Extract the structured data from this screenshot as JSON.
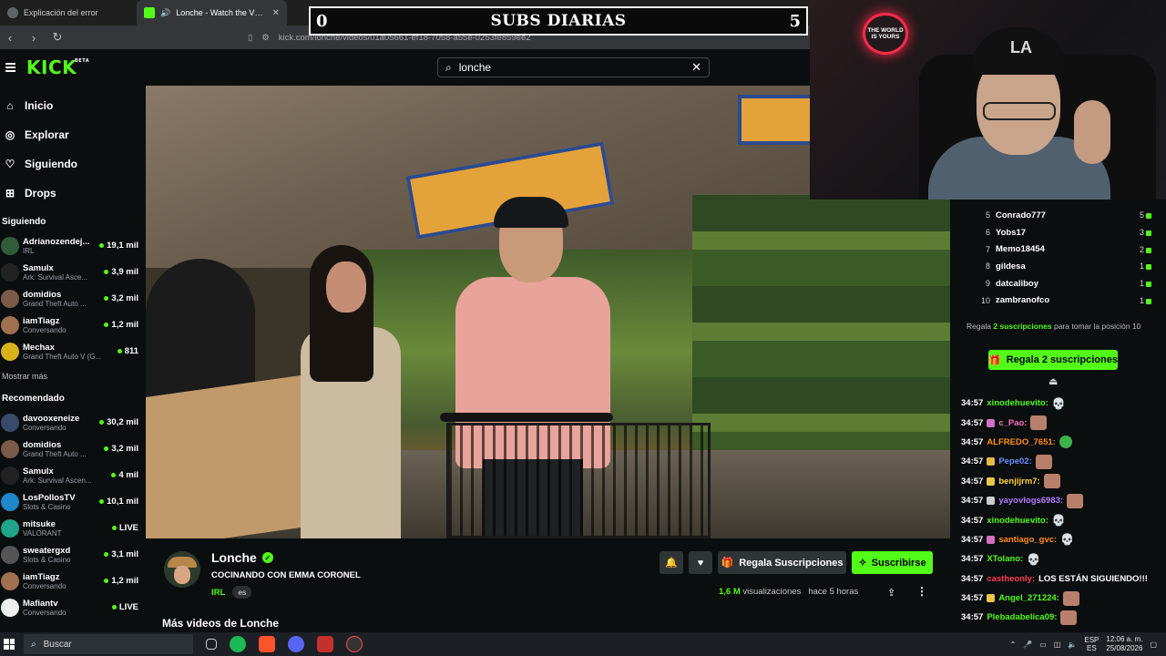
{
  "browser": {
    "tabs": [
      {
        "title": "Explicación del error",
        "active": false
      },
      {
        "title": "Lonche - Watch the VOD on Kick",
        "active": true
      }
    ],
    "url": "kick.com/lonche/videos/01a05661-ef18-7058-a55e-0253fe859ee2"
  },
  "overlay": {
    "subs_title": "SUBS DIARIAS",
    "subs_left": "0",
    "subs_right": "5",
    "neon_sign": "THE WORLD IS YOURS"
  },
  "kick": {
    "logo": "KICK",
    "logo_tag": "BETA",
    "search_value": "lonche"
  },
  "sidebar": {
    "nav": [
      {
        "label": "Inicio",
        "icon": "home-icon"
      },
      {
        "label": "Explorar",
        "icon": "compass-icon"
      },
      {
        "label": "Siguiendo",
        "icon": "heart-icon"
      },
      {
        "label": "Drops",
        "icon": "gift-icon"
      }
    ],
    "following_title": "Siguiendo",
    "following": [
      {
        "name": "Adrianozendej...",
        "category": "IRL",
        "viewers": "19,1 mil",
        "live_dot": true,
        "color": "#2f5d3a"
      },
      {
        "name": "Samulx",
        "category": "Ark: Survival Asce...",
        "viewers": "3,9 mil",
        "live_dot": true,
        "color": "#222222"
      },
      {
        "name": "domidios",
        "category": "Grand Theft Auto ...",
        "viewers": "3,2 mil",
        "live_dot": true,
        "color": "#7a5a48"
      },
      {
        "name": "iamTiagz",
        "category": "Conversando",
        "viewers": "1,2 mil",
        "live_dot": true,
        "color": "#a07050"
      },
      {
        "name": "Mechax",
        "category": "Grand Theft Auto V (G...",
        "viewers": "811",
        "live_dot": true,
        "color": "#d8b21a"
      }
    ],
    "show_more": "Mostrar más",
    "recommended_title": "Recomendado",
    "recommended": [
      {
        "name": "davooxeneize",
        "category": "Conversando",
        "viewers": "30,2 mil",
        "live_dot": true,
        "color": "#3a4a6a"
      },
      {
        "name": "domidios",
        "category": "Grand Theft Auto ...",
        "viewers": "3,2 mil",
        "live_dot": true,
        "color": "#7a5a48"
      },
      {
        "name": "Samulx",
        "category": "Ark: Survival Ascen...",
        "viewers": "4 mil",
        "live_dot": true,
        "color": "#222222"
      },
      {
        "name": "LosPollosTV",
        "category": "Slots & Casino",
        "viewers": "10,1 mil",
        "live_dot": true,
        "color": "#1e88c8"
      },
      {
        "name": "mitsuke",
        "category": "VALORANT",
        "viewers": "LIVE",
        "live_dot": true,
        "color": "#1fa58a"
      },
      {
        "name": "sweatergxd",
        "category": "Slots & Casino",
        "viewers": "3,1 mil",
        "live_dot": true,
        "color": "#555555"
      },
      {
        "name": "iamTiagz",
        "category": "Conversando",
        "viewers": "1,2 mil",
        "live_dot": true,
        "color": "#a07050"
      },
      {
        "name": "Mafiantv",
        "category": "Conversando",
        "viewers": "LIVE",
        "live_dot": true,
        "color": "#eeeeee"
      }
    ]
  },
  "stream": {
    "streamer": "Lonche",
    "title": "COCINANDO CON EMMA CORONEL",
    "category": "IRL",
    "language": "es",
    "gift_subs_label": "Regala Suscripciones",
    "subscribe_label": "Suscribirse",
    "views": "1,6 M",
    "views_label": "visualizaciones",
    "time_ago": "hace 5 horas",
    "more_videos": "Más videos de Lonche"
  },
  "chat": {
    "leaderboard": [
      {
        "rank": "5",
        "user": "Conrado777",
        "count": "5"
      },
      {
        "rank": "6",
        "user": "Yobs17",
        "count": "3"
      },
      {
        "rank": "7",
        "user": "Memo18454",
        "count": "2"
      },
      {
        "rank": "8",
        "user": "gildesa",
        "count": "1"
      },
      {
        "rank": "9",
        "user": "datcaliboy",
        "count": "1"
      },
      {
        "rank": "10",
        "user": "zambranofco",
        "count": "1"
      }
    ],
    "gift_note_pre": "Regala",
    "gift_note_num": "2",
    "gift_note_mid": "suscripciones",
    "gift_note_post": "para tomar la posición 10",
    "gift_button": "Regala 2 suscripciones",
    "messages": [
      {
        "time": "34:57",
        "user": "xinodehuevito:",
        "color": "#53fc18",
        "text": "",
        "badge": "",
        "emote": "skull"
      },
      {
        "time": "34:57",
        "user": "c_Pao:",
        "color": "#ff6ec7",
        "text": "",
        "badge": "#d46fc4",
        "emote": "face"
      },
      {
        "time": "34:57",
        "user": "ALFREDO_7651:",
        "color": "#ff8c1a",
        "text": "",
        "badge": "",
        "emote": "green"
      },
      {
        "time": "34:57",
        "user": "Pepe02:",
        "color": "#6b8cff",
        "text": "",
        "badge": "#e6b84a",
        "emote": "face"
      },
      {
        "time": "34:57",
        "user": "benjijrm7:",
        "color": "#ffd23a",
        "text": "",
        "badge": "#e6c84a",
        "emote": "face"
      },
      {
        "time": "34:57",
        "user": "yayovlogs6983:",
        "color": "#b47cff",
        "text": "",
        "badge": "#cccccc",
        "emote": "face"
      },
      {
        "time": "34:57",
        "user": "xinodehuevito:",
        "color": "#53fc18",
        "text": "",
        "badge": "",
        "emote": "skull"
      },
      {
        "time": "34:57",
        "user": "santiago_gvc:",
        "color": "#ff8c1a",
        "text": "",
        "badge": "#d46fc4",
        "emote": "skull"
      },
      {
        "time": "34:57",
        "user": "XTolano:",
        "color": "#53fc18",
        "text": "",
        "badge": "",
        "emote": "skull"
      },
      {
        "time": "34:57",
        "user": "castheonly:",
        "color": "#ff3c5a",
        "text": "LOS ESTÁN SIGUIENDO!!!",
        "badge": "",
        "emote": ""
      },
      {
        "time": "34:57",
        "user": "Angel_271224:",
        "color": "#53fc18",
        "text": "",
        "badge": "#e6c84a",
        "emote": "face"
      },
      {
        "time": "34:57",
        "user": "Plebadabelica09:",
        "color": "#53fc18",
        "text": "",
        "badge": "",
        "emote": "face"
      }
    ]
  },
  "taskbar": {
    "search": "Buscar",
    "lang_top": "ESP",
    "lang_bottom": "ES",
    "time": "12:06 a. m.",
    "date": "25/08/2026"
  },
  "colors": {
    "kick_green": "#53fc18",
    "bg": "#0b0e0f"
  }
}
